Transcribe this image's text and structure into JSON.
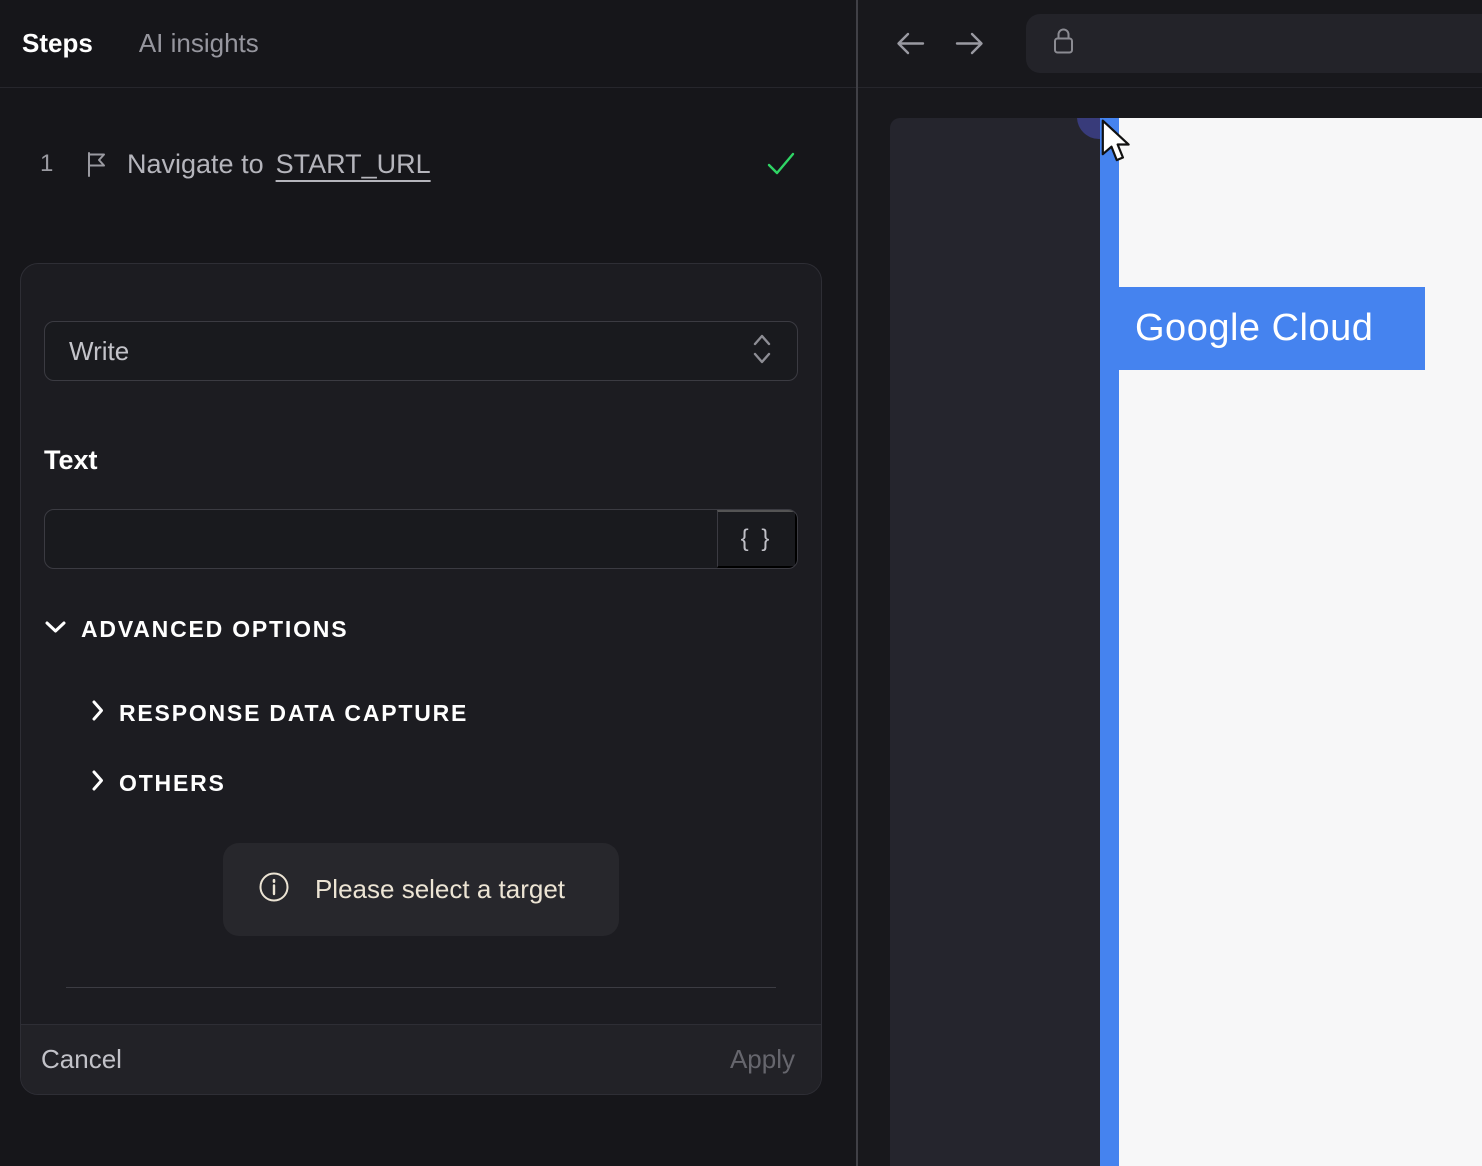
{
  "tabs": [
    {
      "label": "Steps",
      "active": true
    },
    {
      "label": "AI insights",
      "active": false
    }
  ],
  "step": {
    "number": "1",
    "action": "Navigate to",
    "target": "START_URL",
    "status": "success"
  },
  "editor": {
    "action_select": {
      "value": "Write"
    },
    "text_field": {
      "label": "Text",
      "value": "",
      "braces_label": "{ }"
    },
    "advanced": {
      "label": "ADVANCED OPTIONS",
      "expanded": true,
      "sections": [
        {
          "label": "RESPONSE DATA CAPTURE",
          "expanded": false
        },
        {
          "label": "OTHERS",
          "expanded": false
        }
      ]
    },
    "hint": {
      "text": "Please select a target"
    },
    "footer": {
      "cancel": "Cancel",
      "apply": "Apply",
      "apply_enabled": false
    }
  },
  "browser": {
    "address": {
      "value": ""
    }
  },
  "preview": {
    "highlight": {
      "text": "Google Cloud"
    }
  },
  "colors": {
    "accent_blue": "#4583ef",
    "success_green": "#2fd565",
    "hint_text": "#ece4d4",
    "panel_bg": "#16161a",
    "card_bg": "#1c1c21"
  }
}
